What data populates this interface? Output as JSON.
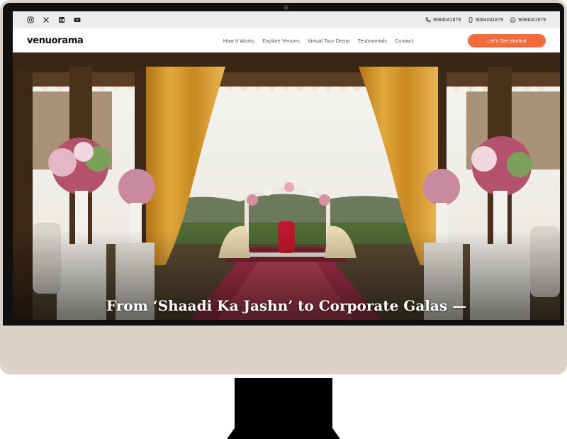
{
  "topbar": {
    "socials": [
      {
        "icon": "instagram-icon"
      },
      {
        "icon": "x-icon"
      },
      {
        "icon": "linkedin-icon"
      },
      {
        "icon": "youtube-icon"
      }
    ],
    "contacts": [
      {
        "icon": "phone-icon",
        "number": "9084041879"
      },
      {
        "icon": "mobile-icon",
        "number": "9084041879"
      },
      {
        "icon": "whatsapp-icon",
        "number": "9084041879"
      }
    ]
  },
  "nav": {
    "logo": "venuorama",
    "links": [
      "How It Works",
      "Explore Venues",
      "Virtual Tour Demo",
      "Testimonials",
      "Contact"
    ],
    "cta": "Let's Get started"
  },
  "hero": {
    "headline": "From ‘Shaadi Ka Jashn’ to Corporate Galas —"
  },
  "colors": {
    "accent": "#f26b3a",
    "frame": "#ddd2c6",
    "curtain": "#d69a2a"
  }
}
